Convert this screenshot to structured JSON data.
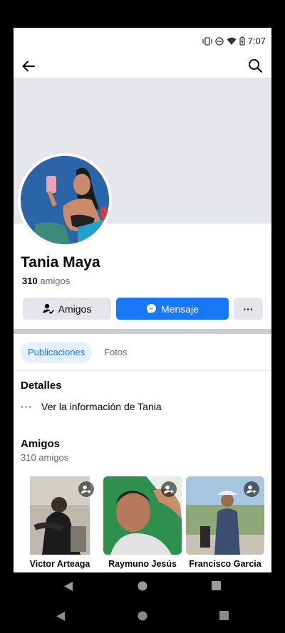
{
  "status": {
    "time": "7:07"
  },
  "profile": {
    "name": "Tania Maya",
    "friends_count": "310",
    "friends_word": "amigos"
  },
  "buttons": {
    "friends": "Amigos",
    "message": "Mensaje",
    "more": "···"
  },
  "tabs": [
    {
      "label": "Publicaciones",
      "active": true
    },
    {
      "label": "Fotos",
      "active": false
    }
  ],
  "details": {
    "heading": "Detalles",
    "info_link": "Ver la información de Tania"
  },
  "friends": {
    "heading": "Amigos",
    "subtitle": "310 amigos",
    "list": [
      {
        "name": "Victor Arteaga"
      },
      {
        "name": "Raymuno Jesús"
      },
      {
        "name": "Francisco Garcia"
      }
    ]
  },
  "colors": {
    "accent": "#1877f2",
    "cover": "#e4e6eb",
    "secondary_text": "#65676b"
  }
}
